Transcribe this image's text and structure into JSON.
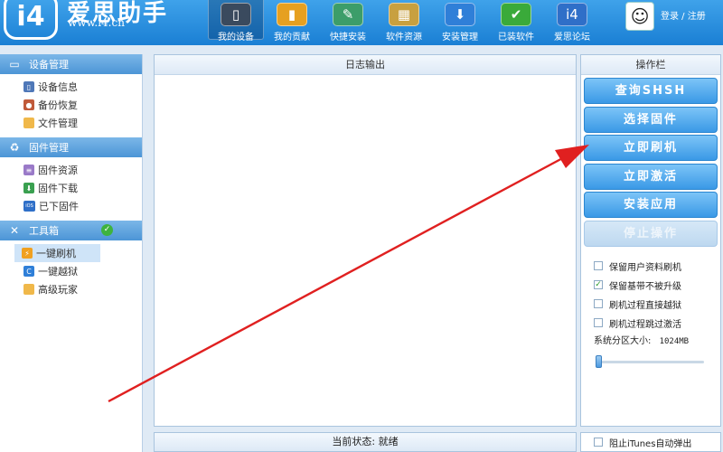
{
  "header": {
    "logo_badge": "i4",
    "logo_name": "爱思助手",
    "logo_url": "www.i4.cn",
    "nav": [
      {
        "label": "我的设备",
        "icon": "phone-icon",
        "glyph": "▯",
        "color": "#3a4a5e",
        "active": true
      },
      {
        "label": "我的贡献",
        "icon": "chart-icon",
        "glyph": "▮",
        "color": "#e6a020",
        "active": false
      },
      {
        "label": "快捷安装",
        "icon": "tools-icon",
        "glyph": "✎",
        "color": "#3c9d6a",
        "active": false
      },
      {
        "label": "软件资源",
        "icon": "apps-icon",
        "glyph": "▦",
        "color": "#c8a040",
        "active": false
      },
      {
        "label": "安装管理",
        "icon": "download-icon",
        "glyph": "⬇",
        "color": "#2f7fd8",
        "active": false
      },
      {
        "label": "已装软件",
        "icon": "installed-icon",
        "glyph": "✔",
        "color": "#3aaa3a",
        "active": false
      },
      {
        "label": "爱思论坛",
        "icon": "forum-icon",
        "glyph": "i4",
        "color": "#2f6fc8",
        "active": false
      }
    ],
    "auth": "登录 / 注册"
  },
  "sidebar": {
    "sections": [
      {
        "title": "设备管理",
        "icon": "monitor-icon",
        "glyph": "▭",
        "check": false,
        "items": [
          {
            "label": "设备信息",
            "icon": "device-info-icon",
            "glyph": "▯",
            "color": "#4f78b8",
            "active": false
          },
          {
            "label": "备份恢复",
            "icon": "backup-icon",
            "glyph": "●",
            "color": "#c05a3a",
            "active": false
          },
          {
            "label": "文件管理",
            "icon": "folder-icon",
            "glyph": "",
            "color": "#f0b84a",
            "active": false
          }
        ]
      },
      {
        "title": "固件管理",
        "icon": "firmware-icon",
        "glyph": "♻",
        "check": false,
        "items": [
          {
            "label": "固件资源",
            "icon": "firmware-res-icon",
            "glyph": "≡",
            "color": "#9a7ac8",
            "active": false
          },
          {
            "label": "固件下载",
            "icon": "firmware-download-icon",
            "glyph": "⬇",
            "color": "#3aa050",
            "active": false
          },
          {
            "label": "已下固件",
            "icon": "ios-icon",
            "glyph": "iOS",
            "color": "#2f6fc8",
            "active": false
          }
        ]
      },
      {
        "title": "工具箱",
        "icon": "toolbox-icon",
        "glyph": "✕",
        "check": true,
        "items": [
          {
            "label": "一键刷机",
            "icon": "flash-icon",
            "glyph": "⚡",
            "color": "#f0a020",
            "active": true
          },
          {
            "label": "一键越狱",
            "icon": "jailbreak-icon",
            "glyph": "C",
            "color": "#2f7fd8",
            "active": false
          },
          {
            "label": "高级玩家",
            "icon": "advanced-folder-icon",
            "glyph": "",
            "color": "#f0b84a",
            "active": false
          }
        ]
      }
    ]
  },
  "log": {
    "title": "日志输出",
    "status": "当前状态: 就绪"
  },
  "ops": {
    "title": "操作栏",
    "buttons": [
      {
        "label": "查询SHSH",
        "disabled": false
      },
      {
        "label": "选择固件",
        "disabled": false
      },
      {
        "label": "立即刷机",
        "disabled": false
      },
      {
        "label": "立即激活",
        "disabled": false
      },
      {
        "label": "安装应用",
        "disabled": false
      },
      {
        "label": "停止操作",
        "disabled": true
      }
    ],
    "options": [
      {
        "label": "保留用户资料刷机",
        "checked": false
      },
      {
        "label": "保留基带不被升级",
        "checked": true
      },
      {
        "label": "刷机过程直接越狱",
        "checked": false
      },
      {
        "label": "刷机过程跳过激活",
        "checked": false
      }
    ],
    "partition_label": "系统分区大小:",
    "partition_value": "1024MB",
    "partition_level": 0.0,
    "itunes": {
      "label": "阻止iTunes自动弹出",
      "checked": false
    }
  },
  "colors": {
    "accent": "#3a99e6",
    "arrow": "#e02020"
  }
}
